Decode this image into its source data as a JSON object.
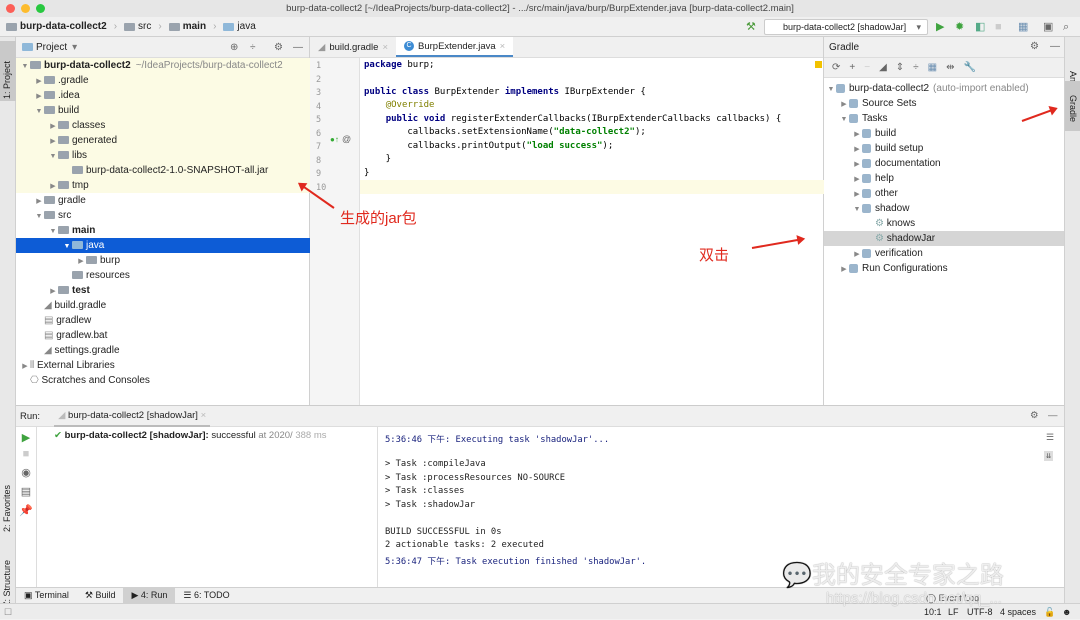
{
  "window": {
    "title": "burp-data-collect2 [~/IdeaProjects/burp-data-collect2] - .../src/main/java/burp/BurpExtender.java [burp-data-collect2.main]"
  },
  "breadcrumb": [
    "burp-data-collect2",
    "src",
    "main",
    "java"
  ],
  "toolbar": {
    "run_config": "burp-data-collect2 [shadowJar]"
  },
  "side_tabs": {
    "project": "1: Project",
    "favorites": "2: Favorites",
    "structure": "Z: Structure",
    "ant": "Ant",
    "gradle": "Gradle"
  },
  "project": {
    "title": "Project",
    "tree": [
      {
        "label": "burp-data-collect2",
        "hint": "~/IdeaProjects/burp-data-collect2"
      },
      {
        "label": ".gradle"
      },
      {
        "label": ".idea"
      },
      {
        "label": "build"
      },
      {
        "label": "classes"
      },
      {
        "label": "generated"
      },
      {
        "label": "libs"
      },
      {
        "label": "burp-data-collect2-1.0-SNAPSHOT-all.jar"
      },
      {
        "label": "tmp"
      },
      {
        "label": "gradle"
      },
      {
        "label": "src"
      },
      {
        "label": "main"
      },
      {
        "label": "java"
      },
      {
        "label": "burp"
      },
      {
        "label": "resources"
      },
      {
        "label": "test"
      },
      {
        "label": "build.gradle"
      },
      {
        "label": "gradlew"
      },
      {
        "label": "gradlew.bat"
      },
      {
        "label": "settings.gradle"
      },
      {
        "label": "External Libraries"
      },
      {
        "label": "Scratches and Consoles"
      }
    ]
  },
  "editor": {
    "tabs": [
      "build.gradle",
      "BurpExtender.java"
    ],
    "active_tab": "BurpExtender.java",
    "line_numbers": [
      "1",
      "2",
      "3",
      "4",
      "5",
      "6",
      "7",
      "8",
      "9",
      "10"
    ]
  },
  "gradle": {
    "title": "Gradle",
    "tree": [
      "burp-data-collect2",
      "(auto-import enabled)",
      "Source Sets",
      "Tasks",
      "build",
      "build setup",
      "documentation",
      "help",
      "other",
      "shadow",
      "knows",
      "shadowJar",
      "verification",
      "Run Configurations"
    ]
  },
  "run": {
    "label": "Run:",
    "tab": "burp-data-collect2 [shadowJar]",
    "result_name": "burp-data-collect2 [shadowJar]:",
    "result_status": "successful",
    "result_time": "at 2020/",
    "result_duration": "388 ms",
    "console": [
      "5:36:46 下午: Executing task 'shadowJar'...",
      "",
      "> Task :compileJava",
      "> Task :processResources NO-SOURCE",
      "> Task :classes",
      "> Task :shadowJar",
      "",
      "BUILD SUCCESSFUL in 0s",
      "2 actionable tasks: 2 executed",
      "5:36:47 下午: Task execution finished 'shadowJar'."
    ]
  },
  "tool_tabs": [
    "Terminal",
    "Build",
    "4: Run",
    "6: TODO"
  ],
  "status": {
    "event_log": "Event Log",
    "position": "10:1",
    "line_sep": "LF",
    "encoding": "UTF-8",
    "indent": "4 spaces"
  },
  "annotations": {
    "jar": "生成的jar包",
    "double_click": "双击"
  },
  "watermark": {
    "text": "我的安全专家之路",
    "url": "https://blog.csdn.net/qq_..."
  },
  "colors": {
    "selection": "#0d5cd6",
    "annotation": "#e0291e",
    "run_green": "#3fa33f"
  }
}
